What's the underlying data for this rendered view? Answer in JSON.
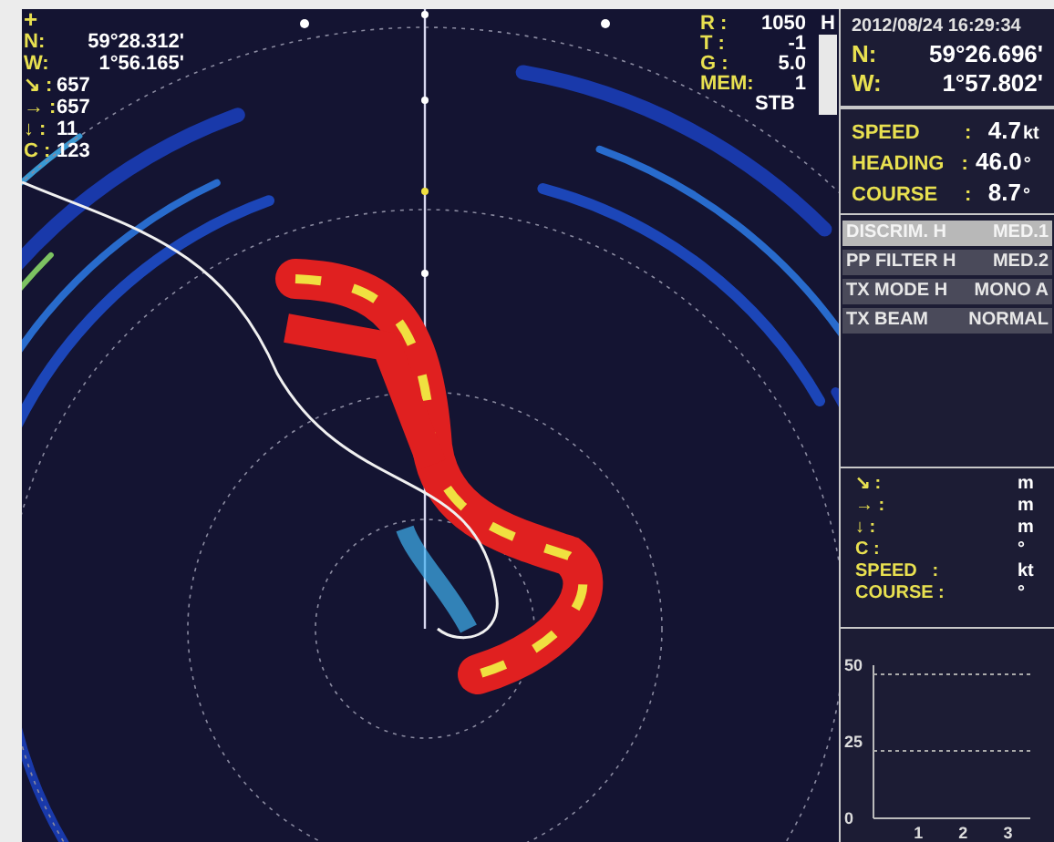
{
  "sonar": {
    "cursor": "+",
    "position": [
      {
        "label": "N:",
        "value": "59°28.312'"
      },
      {
        "label": "W:",
        "value": "1°56.165'"
      }
    ],
    "readouts": [
      {
        "label": "↘ :",
        "value": "657"
      },
      {
        "label": "→ :",
        "value": "657"
      },
      {
        "label": "↓ :",
        "value": "11"
      },
      {
        "label": "C :",
        "value": "123"
      }
    ],
    "settings": [
      {
        "label": "R :",
        "value": "1050"
      },
      {
        "label": "T :",
        "value": "-1"
      },
      {
        "label": "G :",
        "value": "5.0"
      },
      {
        "label": "MEM:",
        "value": "1"
      }
    ],
    "mode": "STB",
    "gain_label": "H"
  },
  "panel": {
    "datetime": "2012/08/24 16:29:34",
    "position": [
      {
        "label": "N:",
        "value": "59°26.696'"
      },
      {
        "label": "W:",
        "value": "1°57.802'"
      }
    ],
    "navigation": [
      {
        "label": "SPEED",
        "separator": ":",
        "value": "4.7",
        "unit": "kt"
      },
      {
        "label": "HEADING",
        "separator": ":",
        "value": "46.0",
        "unit": "°"
      },
      {
        "label": "COURSE",
        "separator": ":",
        "value": "8.7",
        "unit": "°"
      }
    ],
    "menu": [
      {
        "label": "DISCRIM. H",
        "value": "MED.1",
        "selected": true
      },
      {
        "label": "PP FILTER H",
        "value": "MED.2",
        "selected": false
      },
      {
        "label": "TX MODE H",
        "value": "MONO A",
        "selected": false
      },
      {
        "label": "TX BEAM",
        "value": "NORMAL",
        "selected": false
      }
    ],
    "target": [
      {
        "label": "↘ :",
        "unit": "m"
      },
      {
        "label": "→ :",
        "unit": "m"
      },
      {
        "label": "↓ :",
        "unit": "m"
      },
      {
        "label": "C :",
        "unit": "°"
      },
      {
        "label": "SPEED   :",
        "unit": "kt"
      },
      {
        "label": "COURSE :",
        "unit": "°"
      }
    ],
    "chart_data": {
      "type": "bar",
      "xticks": [
        1,
        2,
        3
      ],
      "yticks": [
        0,
        25,
        50
      ],
      "ylim": [
        0,
        50
      ],
      "xlim": [
        0,
        3.5
      ]
    }
  }
}
